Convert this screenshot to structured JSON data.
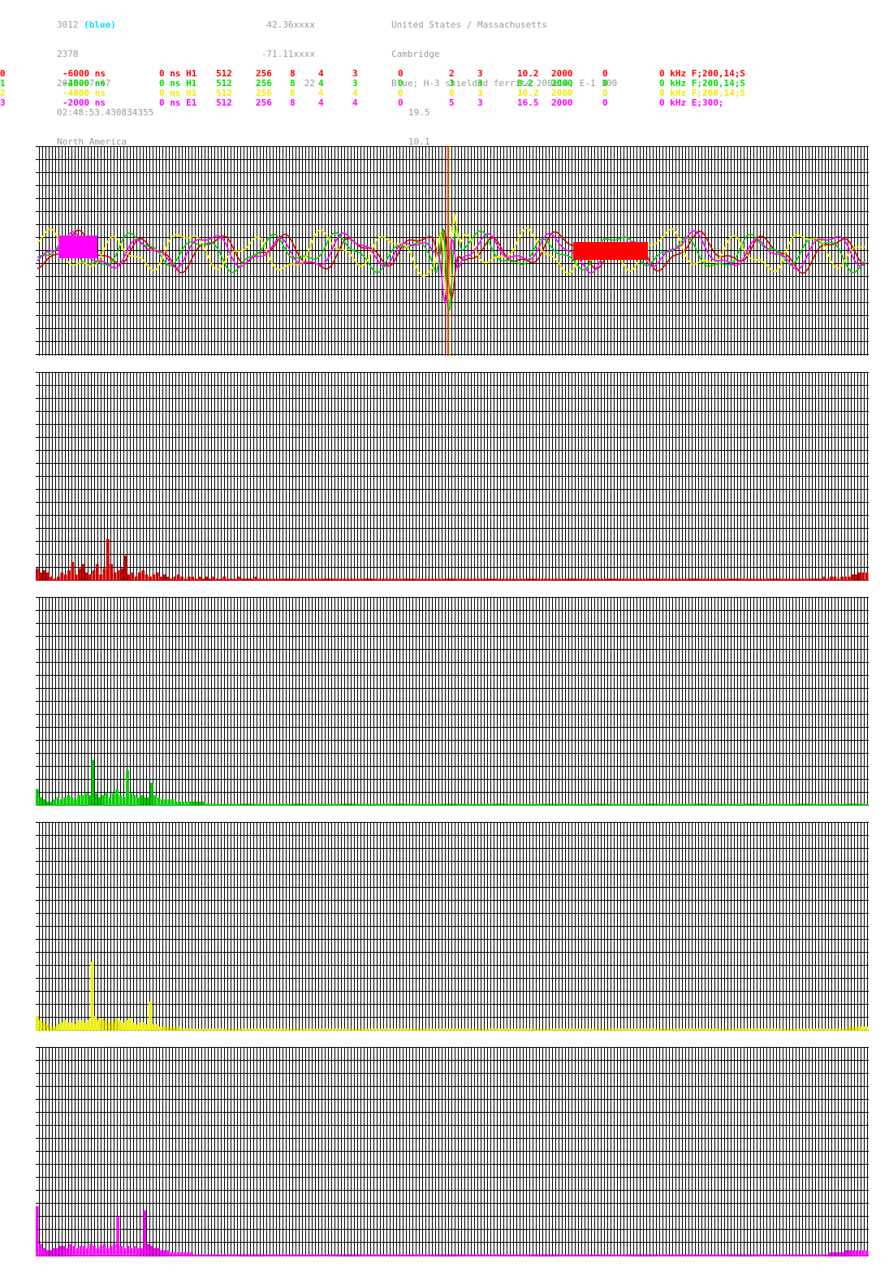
{
  "header": {
    "col1": [
      {
        "main": "3012",
        "extra": "(blue)"
      },
      {
        "main": "2378"
      },
      {
        "main": "2025-07-07"
      },
      {
        "main": "02:48:53.430834355"
      },
      {
        "main": "North America"
      }
    ],
    "col2": [
      "42.36xxxx",
      "-71.11xxxx",
      "22"
    ],
    "col3": [
      "United States / Massachusetts",
      "Cambridge",
      "Blue; H-3 shielded ferrite 200x14; E-1 300",
      "19.5",
      "10.1"
    ]
  },
  "channels": [
    {
      "color": "#ff0000",
      "cells": [
        "0",
        "-6000 ns",
        "0 ns H1",
        "512",
        "256",
        "8",
        "4",
        "3",
        "0",
        "2",
        "3",
        "10.2",
        "2000",
        "0",
        "0 kHz F;200,14;S"
      ]
    },
    {
      "color": "#00dd00",
      "cells": [
        "1",
        "-4000 ns",
        "0 ns H1",
        "512",
        "256",
        "8",
        "4",
        "3",
        "0",
        "3",
        "3",
        "8.2",
        "2000",
        "0",
        "0 kHz F;200,14;S"
      ]
    },
    {
      "color": "#eeee00",
      "cells": [
        "2",
        "-4000 ns",
        "0 ns H1",
        "512",
        "256",
        "8",
        "4",
        "4",
        "0",
        "0",
        "3",
        "10.2",
        "2000",
        "0",
        "0 kHz F;200,14;S"
      ]
    },
    {
      "color": "#ff00ff",
      "cells": [
        "3",
        "-2000 ns",
        "0 ns E1",
        "512",
        "256",
        "8",
        "4",
        "4",
        "0",
        "5",
        "3",
        "16.5",
        "2000",
        "0",
        "0 kHz E;300;"
      ]
    }
  ],
  "colors": {
    "grid": "#000000",
    "red": "#cc0000",
    "green": "#00cc00",
    "yellow": "#eeee00",
    "magenta": "#ff00ff",
    "marker_red": "#ff0000",
    "marker_orange": "#ffaa00"
  },
  "chart_data": [
    {
      "type": "line",
      "title": "",
      "series": [
        "red",
        "green",
        "yellow",
        "magenta"
      ],
      "grid": true,
      "marker_index": 0.495
    },
    {
      "type": "bar",
      "title": "",
      "series_color": "red",
      "values": [
        0.06,
        0.04,
        0.05,
        0.04,
        0.02,
        0.01,
        0.02,
        0.04,
        0.03,
        0.05,
        0.09,
        0.03,
        0.06,
        0.08,
        0.04,
        0.03,
        0.05,
        0.08,
        0.03,
        0.06,
        0.2,
        0.08,
        0.04,
        0.05,
        0.06,
        0.12,
        0.03,
        0.04,
        0.02,
        0.04,
        0.05,
        0.03,
        0.02,
        0.03,
        0.04,
        0.02,
        0.03,
        0.02,
        0.01,
        0.02,
        0.03,
        0.02,
        0.01,
        0.02,
        0.02,
        0.01,
        0.02,
        0.01,
        0.02,
        0.01,
        0.02,
        0.01,
        0.01,
        0.02,
        0.01,
        0.01,
        0.01,
        0.02,
        0.01,
        0.01,
        0.01,
        0.01,
        0.02,
        0.01,
        0.01,
        0.01,
        0.01,
        0.01,
        0.01,
        0.01,
        0.01,
        0.01,
        0.01,
        0.01,
        0.01,
        0.01,
        0.01,
        0.01,
        0.01,
        0.01,
        0.01,
        0.01,
        0.01,
        0.01,
        0.01,
        0.01,
        0.01,
        0.01,
        0.01,
        0.01,
        0.01,
        0.01,
        0.01,
        0.01,
        0.01,
        0.01,
        0.01,
        0.01,
        0.01,
        0.01,
        0.01,
        0.01,
        0.01,
        0.01,
        0.01,
        0.01,
        0.01,
        0.01,
        0.01,
        0.01,
        0.01,
        0.01,
        0.01,
        0.01,
        0.01,
        0.01,
        0.01,
        0.01,
        0.01,
        0.01,
        0.01,
        0.01,
        0.01,
        0.01,
        0.01,
        0.01,
        0.01,
        0.01,
        0.01,
        0.01,
        0.01,
        0.01,
        0.01,
        0.01,
        0.01,
        0.01,
        0.01,
        0.01,
        0.01,
        0.01,
        0.01,
        0.01,
        0.01,
        0.01,
        0.01,
        0.01,
        0.01,
        0.01,
        0.01,
        0.01,
        0.01,
        0.01,
        0.01,
        0.01,
        0.01,
        0.01,
        0.01,
        0.01,
        0.01,
        0.01,
        0.01,
        0.01,
        0.01,
        0.01,
        0.01,
        0.01,
        0.01,
        0.01,
        0.01,
        0.01,
        0.01,
        0.01,
        0.01,
        0.01,
        0.01,
        0.01,
        0.01,
        0.01,
        0.01,
        0.01,
        0.01,
        0.01,
        0.01,
        0.01,
        0.01,
        0.01,
        0.01,
        0.01,
        0.01,
        0.01,
        0.01,
        0.01,
        0.01,
        0.01,
        0.01,
        0.01,
        0.01,
        0.01,
        0.01,
        0.01,
        0.01,
        0.01,
        0.01,
        0.01,
        0.01,
        0.01,
        0.01,
        0.01,
        0.01,
        0.01,
        0.01,
        0.01,
        0.01,
        0.01,
        0.01,
        0.01,
        0.01,
        0.01,
        0.01,
        0.01,
        0.01,
        0.01,
        0.01,
        0.02,
        0.01,
        0.02,
        0.02,
        0.01,
        0.02,
        0.02,
        0.02,
        0.03,
        0.03,
        0.04,
        0.04,
        0.04
      ]
    },
    {
      "type": "bar",
      "title": "",
      "series_color": "green",
      "values": [
        0.08,
        0.04,
        0.03,
        0.02,
        0.02,
        0.03,
        0.04,
        0.03,
        0.04,
        0.05,
        0.04,
        0.03,
        0.05,
        0.05,
        0.06,
        0.05,
        0.22,
        0.06,
        0.04,
        0.05,
        0.06,
        0.04,
        0.06,
        0.08,
        0.05,
        0.04,
        0.17,
        0.06,
        0.05,
        0.04,
        0.05,
        0.04,
        0.04,
        0.11,
        0.05,
        0.04,
        0.03,
        0.03,
        0.03,
        0.03,
        0.02,
        0.02,
        0.02,
        0.02,
        0.02,
        0.02,
        0.02,
        0.02,
        0.02,
        0.01,
        0.01,
        0.01,
        0.01,
        0.01,
        0.01,
        0.01,
        0.01,
        0.01,
        0.01,
        0.01,
        0.01,
        0.01,
        0.01,
        0.01,
        0.01,
        0.01,
        0.01,
        0.01,
        0.01,
        0.01,
        0.01,
        0.01,
        0.01,
        0.01,
        0.01,
        0.01,
        0.01,
        0.01,
        0.01,
        0.01,
        0.01,
        0.01,
        0.01,
        0.01,
        0.01,
        0.01,
        0.01,
        0.01,
        0.01,
        0.01,
        0.01,
        0.01,
        0.01,
        0.01,
        0.01,
        0.01,
        0.01,
        0.01,
        0.01,
        0.01,
        0.01,
        0.01,
        0.01,
        0.01,
        0.01,
        0.01,
        0.01,
        0.01,
        0.01,
        0.01,
        0.01,
        0.01,
        0.01,
        0.01,
        0.01,
        0.01,
        0.01,
        0.01,
        0.01,
        0.01,
        0.01,
        0.01,
        0.01,
        0.01,
        0.01,
        0.01,
        0.01,
        0.01,
        0.01,
        0.01,
        0.01,
        0.01,
        0.01,
        0.01,
        0.01,
        0.01,
        0.01,
        0.01,
        0.01,
        0.01,
        0.01,
        0.01,
        0.01,
        0.01,
        0.01,
        0.01,
        0.01,
        0.01,
        0.01,
        0.01,
        0.01,
        0.01,
        0.01,
        0.01,
        0.01,
        0.01,
        0.01,
        0.01,
        0.01,
        0.01,
        0.01,
        0.01,
        0.01,
        0.01,
        0.01,
        0.01,
        0.01,
        0.01,
        0.01,
        0.01,
        0.01,
        0.01,
        0.01,
        0.01,
        0.01,
        0.01,
        0.01,
        0.01,
        0.01,
        0.01,
        0.01,
        0.01,
        0.01,
        0.01,
        0.01,
        0.01,
        0.01,
        0.01,
        0.01,
        0.01,
        0.01,
        0.01,
        0.01,
        0.01,
        0.01,
        0.01,
        0.01,
        0.01,
        0.01,
        0.01,
        0.01,
        0.01,
        0.01,
        0.01,
        0.01,
        0.01,
        0.01,
        0.01,
        0.01,
        0.01,
        0.01,
        0.01,
        0.01,
        0.01,
        0.01,
        0.01,
        0.01,
        0.01,
        0.01,
        0.01,
        0.01,
        0.01,
        0.01,
        0.01,
        0.01,
        0.01,
        0.01,
        0.01,
        0.01,
        0.01,
        0.01,
        0.01,
        0.01,
        0.01,
        0.01,
        0.01,
        0.01,
        0.01,
        0.01,
        0.01
      ]
    },
    {
      "type": "bar",
      "title": "",
      "series_color": "yellow",
      "values": [
        0.07,
        0.05,
        0.04,
        0.03,
        0.02,
        0.02,
        0.03,
        0.04,
        0.05,
        0.04,
        0.04,
        0.03,
        0.05,
        0.05,
        0.04,
        0.05,
        0.33,
        0.07,
        0.05,
        0.06,
        0.05,
        0.04,
        0.04,
        0.06,
        0.05,
        0.04,
        0.05,
        0.06,
        0.04,
        0.03,
        0.04,
        0.04,
        0.03,
        0.14,
        0.03,
        0.03,
        0.02,
        0.02,
        0.02,
        0.02,
        0.02,
        0.02,
        0.01,
        0.01,
        0.01,
        0.01,
        0.01,
        0.01,
        0.01,
        0.01,
        0.01,
        0.01,
        0.01,
        0.01,
        0.01,
        0.01,
        0.01,
        0.01,
        0.01,
        0.01,
        0.01,
        0.01,
        0.01,
        0.01,
        0.01,
        0.01,
        0.01,
        0.01,
        0.01,
        0.01,
        0.01,
        0.01,
        0.01,
        0.01,
        0.01,
        0.01,
        0.01,
        0.01,
        0.01,
        0.01,
        0.01,
        0.01,
        0.01,
        0.01,
        0.01,
        0.01,
        0.01,
        0.01,
        0.01,
        0.01,
        0.01,
        0.01,
        0.01,
        0.01,
        0.01,
        0.01,
        0.01,
        0.01,
        0.01,
        0.01,
        0.01,
        0.01,
        0.01,
        0.01,
        0.01,
        0.01,
        0.01,
        0.01,
        0.01,
        0.01,
        0.01,
        0.01,
        0.01,
        0.01,
        0.01,
        0.01,
        0.01,
        0.01,
        0.01,
        0.01,
        0.01,
        0.01,
        0.01,
        0.01,
        0.01,
        0.01,
        0.01,
        0.01,
        0.01,
        0.01,
        0.01,
        0.01,
        0.01,
        0.01,
        0.01,
        0.01,
        0.01,
        0.01,
        0.01,
        0.01,
        0.01,
        0.01,
        0.01,
        0.01,
        0.01,
        0.01,
        0.01,
        0.01,
        0.01,
        0.01,
        0.01,
        0.01,
        0.01,
        0.01,
        0.01,
        0.01,
        0.01,
        0.01,
        0.01,
        0.01,
        0.01,
        0.01,
        0.01,
        0.01,
        0.01,
        0.01,
        0.01,
        0.01,
        0.01,
        0.01,
        0.01,
        0.01,
        0.01,
        0.01,
        0.01,
        0.01,
        0.01,
        0.01,
        0.01,
        0.01,
        0.01,
        0.01,
        0.01,
        0.01,
        0.01,
        0.01,
        0.01,
        0.01,
        0.01,
        0.01,
        0.01,
        0.01,
        0.01,
        0.01,
        0.01,
        0.01,
        0.01,
        0.01,
        0.01,
        0.01,
        0.01,
        0.01,
        0.01,
        0.01,
        0.01,
        0.01,
        0.01,
        0.01,
        0.01,
        0.01,
        0.01,
        0.01,
        0.01,
        0.01,
        0.01,
        0.01,
        0.01,
        0.01,
        0.01,
        0.01,
        0.01,
        0.01,
        0.01,
        0.01,
        0.01,
        0.01,
        0.01,
        0.01,
        0.01,
        0.01,
        0.01,
        0.01,
        0.01,
        0.01,
        0.01,
        0.01,
        0.01,
        0.02,
        0.02,
        0.02,
        0.02,
        0.02,
        0.02
      ]
    },
    {
      "type": "bar",
      "title": "",
      "series_color": "magenta",
      "values": [
        0.24,
        0.06,
        0.04,
        0.03,
        0.03,
        0.04,
        0.04,
        0.05,
        0.05,
        0.04,
        0.06,
        0.05,
        0.04,
        0.05,
        0.05,
        0.04,
        0.06,
        0.05,
        0.04,
        0.05,
        0.06,
        0.04,
        0.05,
        0.06,
        0.19,
        0.05,
        0.04,
        0.05,
        0.04,
        0.05,
        0.04,
        0.04,
        0.22,
        0.06,
        0.05,
        0.04,
        0.04,
        0.03,
        0.03,
        0.03,
        0.02,
        0.02,
        0.02,
        0.02,
        0.02,
        0.02,
        0.02,
        0.01,
        0.01,
        0.01,
        0.01,
        0.01,
        0.01,
        0.01,
        0.01,
        0.01,
        0.01,
        0.01,
        0.01,
        0.01,
        0.01,
        0.01,
        0.01,
        0.01,
        0.01,
        0.01,
        0.01,
        0.01,
        0.01,
        0.01,
        0.01,
        0.01,
        0.01,
        0.01,
        0.01,
        0.01,
        0.01,
        0.01,
        0.01,
        0.01,
        0.01,
        0.01,
        0.01,
        0.01,
        0.01,
        0.01,
        0.01,
        0.01,
        0.01,
        0.01,
        0.01,
        0.01,
        0.01,
        0.01,
        0.01,
        0.01,
        0.01,
        0.01,
        0.01,
        0.01,
        0.01,
        0.01,
        0.01,
        0.01,
        0.01,
        0.01,
        0.01,
        0.01,
        0.01,
        0.01,
        0.01,
        0.01,
        0.01,
        0.01,
        0.01,
        0.01,
        0.01,
        0.01,
        0.01,
        0.01,
        0.01,
        0.01,
        0.01,
        0.01,
        0.01,
        0.01,
        0.01,
        0.01,
        0.01,
        0.01,
        0.01,
        0.01,
        0.01,
        0.01,
        0.01,
        0.01,
        0.01,
        0.01,
        0.01,
        0.01,
        0.01,
        0.01,
        0.01,
        0.01,
        0.01,
        0.01,
        0.01,
        0.01,
        0.01,
        0.01,
        0.01,
        0.01,
        0.01,
        0.01,
        0.01,
        0.01,
        0.01,
        0.01,
        0.01,
        0.01,
        0.01,
        0.01,
        0.01,
        0.01,
        0.01,
        0.01,
        0.01,
        0.01,
        0.01,
        0.01,
        0.01,
        0.01,
        0.01,
        0.01,
        0.01,
        0.01,
        0.01,
        0.01,
        0.01,
        0.01,
        0.01,
        0.01,
        0.01,
        0.01,
        0.01,
        0.01,
        0.01,
        0.01,
        0.01,
        0.01,
        0.01,
        0.01,
        0.01,
        0.01,
        0.01,
        0.01,
        0.01,
        0.01,
        0.01,
        0.01,
        0.01,
        0.01,
        0.01,
        0.01,
        0.01,
        0.01,
        0.01,
        0.01,
        0.01,
        0.01,
        0.01,
        0.01,
        0.01,
        0.01,
        0.01,
        0.01,
        0.01,
        0.01,
        0.01,
        0.01,
        0.01,
        0.01,
        0.01,
        0.01,
        0.01,
        0.01,
        0.01,
        0.01,
        0.01,
        0.01,
        0.01,
        0.01,
        0.01,
        0.01,
        0.01,
        0.01,
        0.02,
        0.02,
        0.02,
        0.02,
        0.02,
        0.03,
        0.03,
        0.03,
        0.03,
        0.03,
        0.03,
        0.03
      ]
    }
  ]
}
